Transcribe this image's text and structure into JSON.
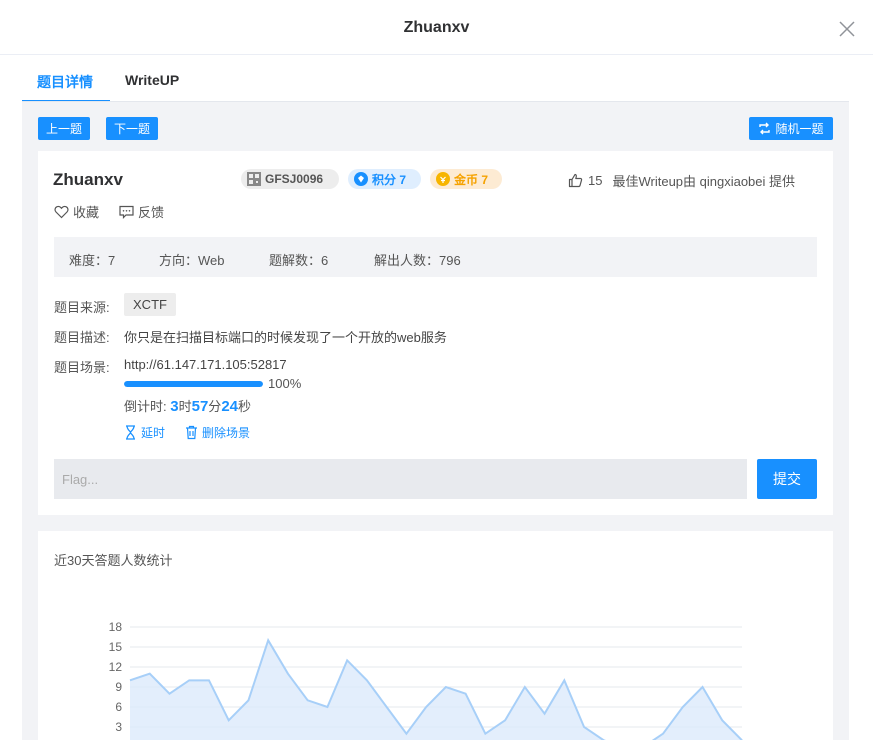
{
  "header": {
    "title": "Zhuanxv"
  },
  "tabs": [
    {
      "label": "题目详情",
      "active": true
    },
    {
      "label": "WriteUP",
      "active": false
    }
  ],
  "nav": {
    "prev": "上一题",
    "next": "下一题",
    "random": "随机一题"
  },
  "challenge": {
    "name": "Zhuanxv",
    "code": "GFSJ0096",
    "score_label": "积分 7",
    "gold_label": "金币 7",
    "likes": "15",
    "best_writeup": "最佳Writeup由 qingxiaobei 提供",
    "favorite": "收藏",
    "feedback": "反馈"
  },
  "stats": {
    "difficulty": "难度：7",
    "direction": "方向：Web",
    "writeups": "题解数：6",
    "solvers": "解出人数：796"
  },
  "details": {
    "source_label": "题目来源:",
    "source_value": "XCTF",
    "desc_label": "题目描述:",
    "desc_value": "你只是在扫描目标端口的时候发现了一个开放的web服务",
    "scene_label": "题目场景:",
    "scene_url": "http://61.147.171.105:52817",
    "progress": 1.0,
    "progress_text": "100%",
    "countdown_prefix": "倒计时:",
    "hours": "3",
    "hours_unit": "时",
    "minutes": "57",
    "minutes_unit": "分",
    "seconds": "24",
    "seconds_unit": "秒",
    "extend": "延时",
    "delete_scene": "删除场景"
  },
  "flag": {
    "placeholder": "Flag...",
    "submit": "提交"
  },
  "chart_data": {
    "type": "area",
    "title": "近30天答题人数统计",
    "yticks": [
      3,
      6,
      9,
      12,
      15,
      18
    ],
    "ylim": [
      0,
      18
    ],
    "values": [
      10,
      11,
      8,
      10,
      10,
      4,
      7,
      16,
      11,
      7,
      6,
      13,
      10,
      6,
      2,
      6,
      9,
      8,
      2,
      4,
      9,
      5,
      10,
      3,
      1,
      0,
      0,
      2,
      6,
      9,
      4,
      1
    ],
    "series_color": "#a7cff8",
    "fill_color": "#dceafb"
  }
}
